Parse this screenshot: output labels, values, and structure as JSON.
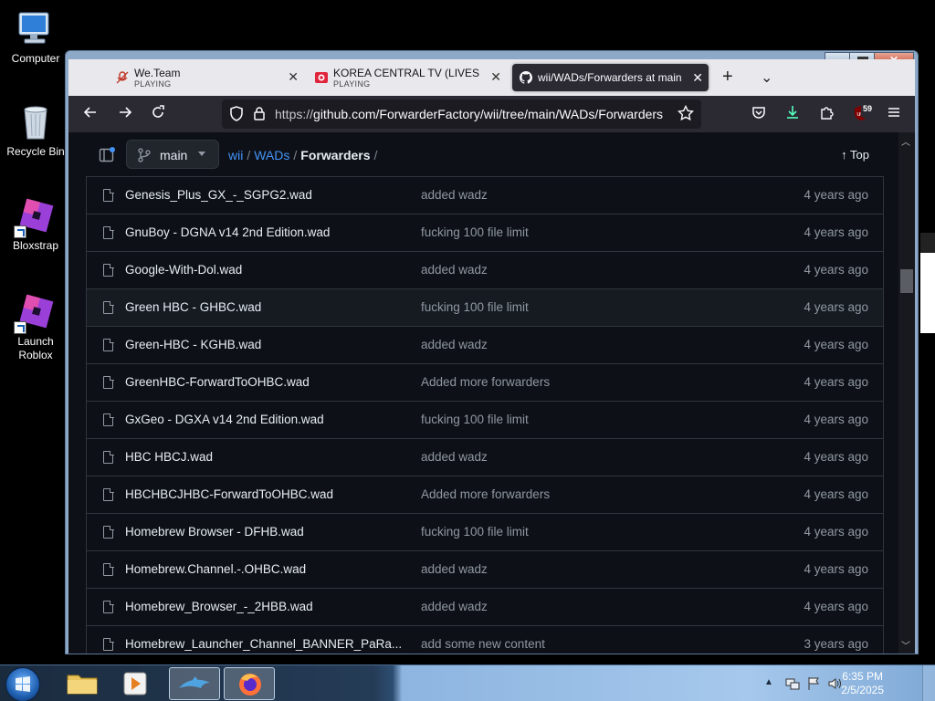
{
  "desktop": {
    "icons": [
      {
        "label": "Computer"
      },
      {
        "label": "Recycle Bin"
      },
      {
        "label": "Bloxstrap"
      },
      {
        "label": "Launch Roblox"
      }
    ]
  },
  "browser": {
    "tabs": [
      {
        "title": "We.Team",
        "status": "PLAYING"
      },
      {
        "title": "KOREA CENTRAL TV (LIVESTRE",
        "status": "PLAYING"
      },
      {
        "title": "wii/WADs/Forwarders at main"
      }
    ],
    "url_prefix": "https://",
    "url_rest": "github.com/ForwarderFactory/wii/tree/main/WADs/Forwarders",
    "extension_badge": "59"
  },
  "repo": {
    "branch": "main",
    "breadcrumb": {
      "repo": "wii",
      "folder": "WADs",
      "current": "Forwarders",
      "trail_sep": "/"
    },
    "top_label": "Top",
    "files": [
      {
        "name": "Genesis_Plus_GX_-_SGPG2.wad",
        "message": "added wadz",
        "age": "4 years ago"
      },
      {
        "name": "GnuBoy - DGNA v14 2nd Edition.wad",
        "message": "fucking 100 file limit",
        "age": "4 years ago"
      },
      {
        "name": "Google-With-Dol.wad",
        "message": "added wadz",
        "age": "4 years ago"
      },
      {
        "name": "Green HBC - GHBC.wad",
        "message": "fucking 100 file limit",
        "age": "4 years ago"
      },
      {
        "name": "Green-HBC - KGHB.wad",
        "message": "added wadz",
        "age": "4 years ago"
      },
      {
        "name": "GreenHBC-ForwardToOHBC.wad",
        "message": "Added more forwarders",
        "age": "4 years ago"
      },
      {
        "name": "GxGeo - DGXA v14 2nd Edition.wad",
        "message": "fucking 100 file limit",
        "age": "4 years ago"
      },
      {
        "name": "HBC HBCJ.wad",
        "message": "added wadz",
        "age": "4 years ago"
      },
      {
        "name": "HBCHBCJHBC-ForwardToOHBC.wad",
        "message": "Added more forwarders",
        "age": "4 years ago"
      },
      {
        "name": "Homebrew Browser - DFHB.wad",
        "message": "fucking 100 file limit",
        "age": "4 years ago"
      },
      {
        "name": "Homebrew.Channel.-.OHBC.wad",
        "message": "added wadz",
        "age": "4 years ago"
      },
      {
        "name": "Homebrew_Browser_-_2HBB.wad",
        "message": "added wadz",
        "age": "4 years ago"
      },
      {
        "name": "Homebrew_Launcher_Channel_BANNER_PaRa...",
        "message": "add some new content",
        "age": "3 years ago"
      }
    ]
  },
  "taskbar": {
    "time": "6:35 PM",
    "date": "2/5/2025"
  },
  "colors": {
    "github_bg": "#0d1117",
    "link": "#4493f8",
    "muted": "#9198a1",
    "border": "#30363d",
    "firefox_toolbar": "#2b2a33"
  }
}
